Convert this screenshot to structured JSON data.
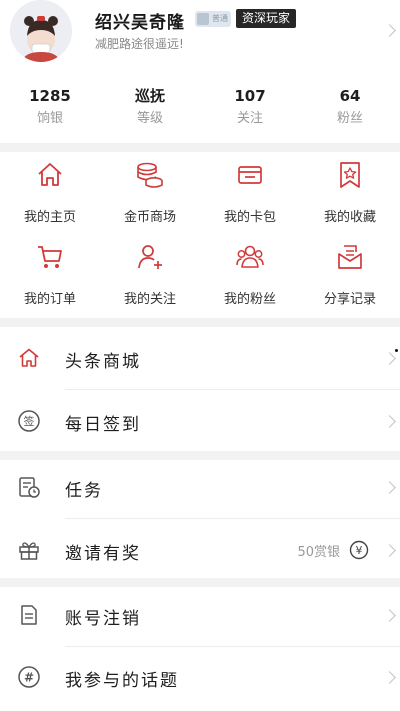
{
  "profile": {
    "nickname": "绍兴吴奇隆",
    "level_badge": "普通",
    "rank_tag": "资深玩家",
    "signature": "减肥路途很遥远!"
  },
  "stats": [
    {
      "value": "1285",
      "label": "饷银"
    },
    {
      "value": "巡抚",
      "label": "等级"
    },
    {
      "value": "107",
      "label": "关注"
    },
    {
      "value": "64",
      "label": "粉丝"
    }
  ],
  "grid": [
    {
      "label": "我的主页",
      "icon": "home-icon"
    },
    {
      "label": "金币商场",
      "icon": "coins-icon"
    },
    {
      "label": "我的卡包",
      "icon": "card-icon"
    },
    {
      "label": "我的收藏",
      "icon": "bookmark-star-icon"
    },
    {
      "label": "我的订单",
      "icon": "cart-icon"
    },
    {
      "label": "我的关注",
      "icon": "user-add-icon"
    },
    {
      "label": "我的粉丝",
      "icon": "users-icon"
    },
    {
      "label": "分享记录",
      "icon": "share-record-icon"
    }
  ],
  "menu": {
    "mall": {
      "label": "头条商城",
      "icon": "home-icon"
    },
    "checkin": {
      "label": "每日签到",
      "icon": "checkin-icon",
      "icon_char": "签"
    },
    "tasks": {
      "label": "任务",
      "icon": "task-clock-icon"
    },
    "invite": {
      "label": "邀请有奖",
      "icon": "gift-icon",
      "reward": "50赏银",
      "reward_icon": "yuan-coin-icon",
      "reward_char": "¥"
    },
    "cancel": {
      "label": "账号注销",
      "icon": "document-icon"
    },
    "topics": {
      "label": "我参与的话题",
      "icon": "hashtag-icon",
      "icon_char": "#"
    }
  },
  "colors": {
    "accent": "#d23a3a",
    "text": "#1e1e1e",
    "muted": "#999999",
    "separator": "#f2f2f2",
    "tag_bg": "#262626"
  }
}
